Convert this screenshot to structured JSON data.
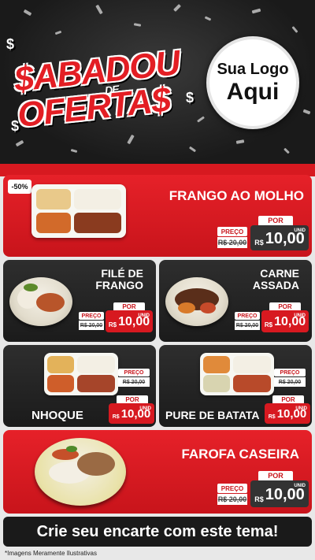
{
  "header": {
    "title_line1": "$ABADOU",
    "title_de": "DE",
    "title_line2": "OFERTA$",
    "logo_line1": "Sua Logo",
    "logo_line2": "Aqui"
  },
  "labels": {
    "preco": "PREÇO",
    "por": "POR",
    "currency": "R$",
    "unid": "UNID"
  },
  "products": {
    "frango_molho": {
      "name": "FRANGO AO MOLHO",
      "discount": "-50%",
      "old_price": "R$ 20,00",
      "new_price": "10,00"
    },
    "file_frango": {
      "name_l1": "FILÉ DE",
      "name_l2": "FRANGO",
      "old_price": "R$ 20,00",
      "new_price": "10,00"
    },
    "carne_assada": {
      "name_l1": "CARNE",
      "name_l2": "ASSADA",
      "old_price": "R$ 20,00",
      "new_price": "10,00"
    },
    "nhoque": {
      "name": "NHOQUE",
      "old_price": "R$ 20,00",
      "new_price": "10,00"
    },
    "pure_batata": {
      "name": "PURE DE BATATA",
      "old_price": "R$ 20,00",
      "new_price": "10,00"
    },
    "farofa": {
      "name": "FAROFA CASEIRA",
      "old_price": "R$ 20,00",
      "new_price": "10,00"
    }
  },
  "cta": "Crie seu encarte com este tema!",
  "disclaimer": "*Imagens Meramente Ilustrativas",
  "colors": {
    "brand_red": "#d71920",
    "dark_card": "#2a2a2a"
  }
}
